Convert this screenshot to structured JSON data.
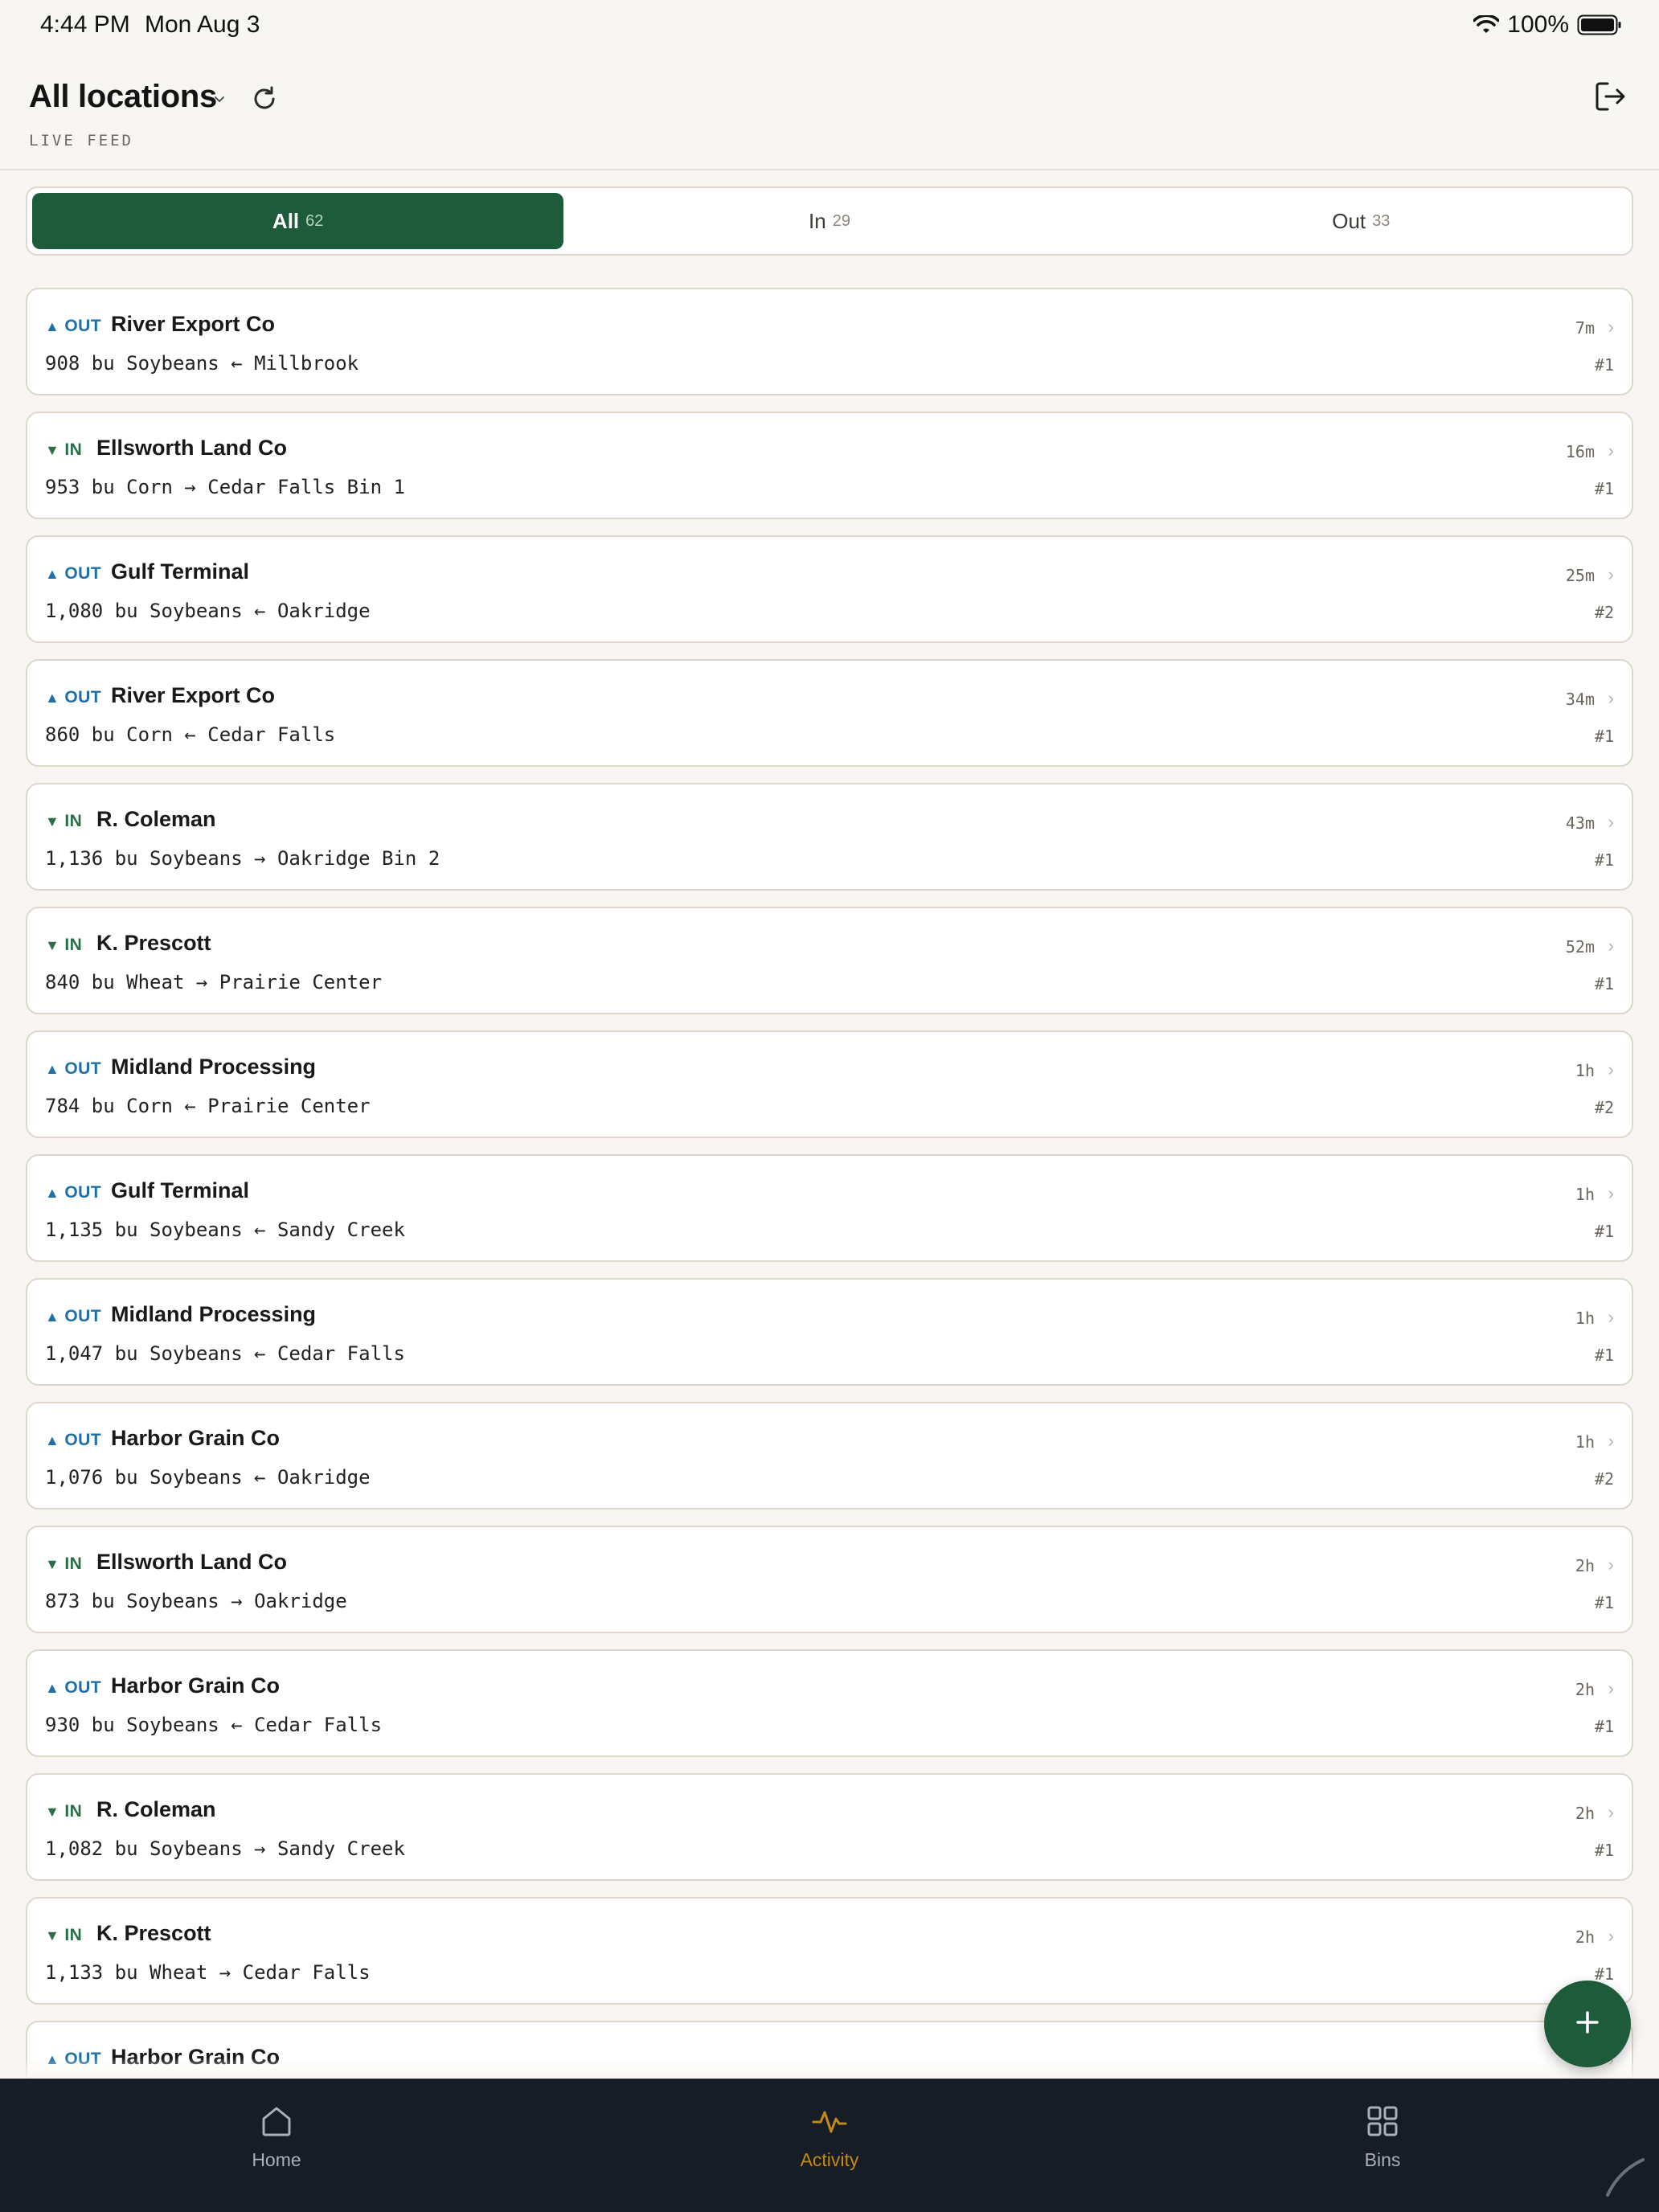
{
  "status_bar": {
    "time": "4:44 PM",
    "date": "Mon Aug 3",
    "battery": "100%"
  },
  "header": {
    "title": "All locations",
    "subtitle": "LIVE FEED"
  },
  "filters": [
    {
      "label": "All",
      "count": "62",
      "active": true
    },
    {
      "label": "In",
      "count": "29",
      "active": false
    },
    {
      "label": "Out",
      "count": "33",
      "active": false
    }
  ],
  "entries": [
    {
      "dir": "OUT",
      "tri": "▲",
      "party": "River Export Co",
      "detail": "908 bu Soybeans ← Millbrook",
      "age": "7m",
      "ticket": "#1"
    },
    {
      "dir": "IN",
      "tri": "▼",
      "party": "Ellsworth Land Co",
      "detail": "953 bu Corn → Cedar Falls Bin 1",
      "age": "16m",
      "ticket": "#1"
    },
    {
      "dir": "OUT",
      "tri": "▲",
      "party": "Gulf Terminal",
      "detail": "1,080 bu Soybeans ← Oakridge",
      "age": "25m",
      "ticket": "#2"
    },
    {
      "dir": "OUT",
      "tri": "▲",
      "party": "River Export Co",
      "detail": "860 bu Corn ← Cedar Falls",
      "age": "34m",
      "ticket": "#1"
    },
    {
      "dir": "IN",
      "tri": "▼",
      "party": "R. Coleman",
      "detail": "1,136 bu Soybeans → Oakridge Bin 2",
      "age": "43m",
      "ticket": "#1"
    },
    {
      "dir": "IN",
      "tri": "▼",
      "party": "K. Prescott",
      "detail": "840 bu Wheat → Prairie Center",
      "age": "52m",
      "ticket": "#1"
    },
    {
      "dir": "OUT",
      "tri": "▲",
      "party": "Midland Processing",
      "detail": "784 bu Corn ← Prairie Center",
      "age": "1h",
      "ticket": "#2"
    },
    {
      "dir": "OUT",
      "tri": "▲",
      "party": "Gulf Terminal",
      "detail": "1,135 bu Soybeans ← Sandy Creek",
      "age": "1h",
      "ticket": "#1"
    },
    {
      "dir": "OUT",
      "tri": "▲",
      "party": "Midland Processing",
      "detail": "1,047 bu Soybeans ← Cedar Falls",
      "age": "1h",
      "ticket": "#1"
    },
    {
      "dir": "OUT",
      "tri": "▲",
      "party": "Harbor Grain Co",
      "detail": "1,076 bu Soybeans ← Oakridge",
      "age": "1h",
      "ticket": "#2"
    },
    {
      "dir": "IN",
      "tri": "▼",
      "party": "Ellsworth Land Co",
      "detail": "873 bu Soybeans → Oakridge",
      "age": "2h",
      "ticket": "#1"
    },
    {
      "dir": "OUT",
      "tri": "▲",
      "party": "Harbor Grain Co",
      "detail": "930 bu Soybeans ← Cedar Falls",
      "age": "2h",
      "ticket": "#1"
    },
    {
      "dir": "IN",
      "tri": "▼",
      "party": "R. Coleman",
      "detail": "1,082 bu Soybeans → Sandy Creek",
      "age": "2h",
      "ticket": "#1"
    },
    {
      "dir": "IN",
      "tri": "▼",
      "party": "K. Prescott",
      "detail": "1,133 bu Wheat → Cedar Falls",
      "age": "2h",
      "ticket": "#1"
    },
    {
      "dir": "OUT",
      "tri": "▲",
      "party": "Harbor Grain Co",
      "detail": "",
      "age": "",
      "ticket": ""
    }
  ],
  "fab": {
    "icon": "plus-icon"
  },
  "nav": [
    {
      "label": "Home",
      "icon": "home-icon",
      "active": false
    },
    {
      "label": "Activity",
      "icon": "activity-icon",
      "active": true
    },
    {
      "label": "Bins",
      "icon": "grid-icon",
      "active": false
    }
  ],
  "colors": {
    "accent": "#1e5b3b",
    "out": "#1f6fa8",
    "in": "#2a6e48",
    "nav_bg": "#161d27",
    "nav_active": "#c48a12"
  }
}
